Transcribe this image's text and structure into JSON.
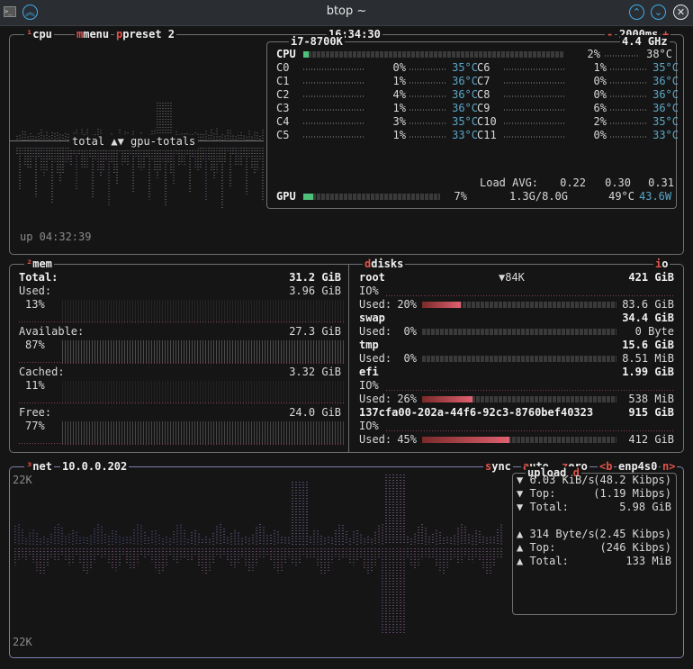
{
  "window": {
    "title": "btop ~"
  },
  "cpu": {
    "labels": {
      "cpu": "cpu",
      "menu": "menu",
      "preset": "preset 2"
    },
    "clock": "16:34:30",
    "interval": "2000ms",
    "minus": "-",
    "plus": "+",
    "graph_label": "total ▲▼ gpu-totals",
    "uptime": "up 04:32:39",
    "model": "i7-8700K",
    "freq": "4.4 GHz",
    "total": {
      "label": "CPU",
      "pct": "2%",
      "temp": "38°C",
      "value": 2
    },
    "cores_left": [
      {
        "name": "C0",
        "pct": "0%",
        "temp": "35°C"
      },
      {
        "name": "C1",
        "pct": "1%",
        "temp": "36°C"
      },
      {
        "name": "C2",
        "pct": "4%",
        "temp": "36°C"
      },
      {
        "name": "C3",
        "pct": "1%",
        "temp": "36°C"
      },
      {
        "name": "C4",
        "pct": "3%",
        "temp": "35°C"
      },
      {
        "name": "C5",
        "pct": "1%",
        "temp": "33°C"
      }
    ],
    "cores_right": [
      {
        "name": "C6",
        "pct": "1%",
        "temp": "35°C"
      },
      {
        "name": "C7",
        "pct": "0%",
        "temp": "36°C"
      },
      {
        "name": "C8",
        "pct": "0%",
        "temp": "36°C"
      },
      {
        "name": "C9",
        "pct": "6%",
        "temp": "36°C"
      },
      {
        "name": "C10",
        "pct": "2%",
        "temp": "35°C"
      },
      {
        "name": "C11",
        "pct": "0%",
        "temp": "33°C"
      }
    ],
    "load_label": "Load AVG:",
    "load": [
      "0.22",
      "0.30",
      "0.31"
    ],
    "gpu": {
      "label": "GPU",
      "pct": "7%",
      "mem": "1.3G/8.0G",
      "temp": "49°C",
      "power": "43.6W",
      "value": 7
    }
  },
  "mem": {
    "label": "mem",
    "rows": [
      {
        "label": "Total:",
        "value": "31.2 GiB",
        "pct": ""
      },
      {
        "label": "Used:",
        "value": "3.96 GiB",
        "pct": "13%"
      },
      {
        "label": "Available:",
        "value": "27.3 GiB",
        "pct": "87%"
      },
      {
        "label": "Cached:",
        "value": "3.32 GiB",
        "pct": "11%"
      },
      {
        "label": "Free:",
        "value": "24.0 GiB",
        "pct": "77%"
      }
    ]
  },
  "disks": {
    "label": "disks",
    "io_label": "io",
    "root": {
      "name": "root",
      "io": "▼84K",
      "size": "421 GiB",
      "io_label": "IO%",
      "used_label": "Used:",
      "used_pct": "20%",
      "used": "83.6 GiB",
      "value": 20
    },
    "swap": {
      "name": "swap",
      "size": "34.4 GiB",
      "used_label": "Used:",
      "used_pct": "0%",
      "used": "0 Byte",
      "value": 0
    },
    "tmp": {
      "name": "tmp",
      "size": "15.6 GiB",
      "used_label": "Used:",
      "used_pct": "0%",
      "used": "8.51 MiB",
      "value": 0
    },
    "efi": {
      "name": "efi",
      "size": "1.99 GiB",
      "io_label": "IO%",
      "used_label": "Used:",
      "used_pct": "26%",
      "used": "538 MiB",
      "value": 26
    },
    "uuid": {
      "name": "137cfa00-202a-44f6-92c3-8760bef40323",
      "size": "915 GiB",
      "io_label": "IO%",
      "used_label": "Used:",
      "used_pct": "45%",
      "used": "412 GiB",
      "value": 45
    }
  },
  "net": {
    "label": "net",
    "ip": "10.0.0.202",
    "sync": "sync",
    "auto": "auto",
    "zero": "zero",
    "prev": "<b",
    "iface": "enp4s0",
    "next": "n>",
    "scale_top": "22K",
    "scale_bottom": "22K",
    "box_title": "upload",
    "box_title_hot": "d",
    "down": [
      {
        "label": "▼ 6.03 KiB/s",
        "value": "(48.2 Kibps)"
      },
      {
        "label": "▼ Top:",
        "value": "(1.19 Mibps)"
      },
      {
        "label": "▼ Total:",
        "value": "5.98 GiB"
      }
    ],
    "up": [
      {
        "label": "▲ 314 Byte/s",
        "value": "(2.45 Kibps)"
      },
      {
        "label": "▲ Top:",
        "value": "(246 Kibps)"
      },
      {
        "label": "▲ Total:",
        "value": "133 MiB"
      }
    ]
  },
  "colors": {
    "accent": "#e0544a",
    "bar_green": "#4fc07a",
    "temp": "#5aa6c8",
    "net_border": "#7c7eb0"
  }
}
